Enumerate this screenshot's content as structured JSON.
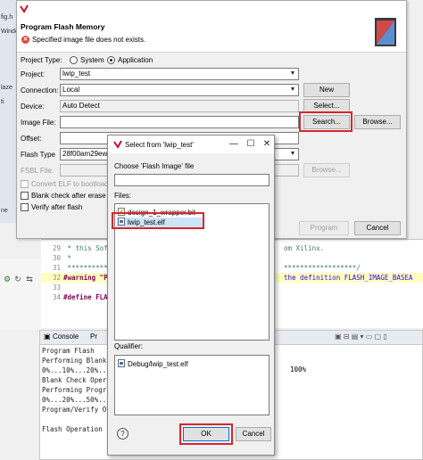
{
  "ide": {
    "side_labels": [
      "fig.h",
      "Windo",
      "laze",
      "ti",
      "ne"
    ],
    "code_lines": [
      {
        "num": "29",
        "text": " * this Soft",
        "tail": "om Xilinx."
      },
      {
        "num": "30",
        "text": " *",
        "tail": ""
      },
      {
        "num": "31",
        "text": " ***********",
        "tail": "******************/"
      },
      {
        "num": "32",
        "text": "#warning \"P",
        "tail": "the definition FLASH_IMAGE_BASEA"
      },
      {
        "num": "33",
        "text": "",
        "tail": ""
      },
      {
        "num": "34",
        "text": "#define FLA",
        "tail": ""
      }
    ],
    "console_tab": "Console",
    "second_tab": "Pr",
    "console_lines": [
      {
        "left": "Program Flash",
        "right": ""
      },
      {
        "left": "Performing Blank",
        "right": ""
      },
      {
        "left": "0%...10%...20%...",
        "right": "100%"
      },
      {
        "left": "Blank Check Oper",
        "right": ""
      },
      {
        "left": "Performing Progr",
        "right": ""
      },
      {
        "left": "0%...20%...50%..",
        "right": ""
      },
      {
        "left": "Program/Verify O",
        "right": ""
      },
      {
        "left": "",
        "right": ""
      },
      {
        "left": "Flash Operation",
        "right": ""
      }
    ]
  },
  "pfm": {
    "title": "Program Flash Memory",
    "error_message": "Specified image file does not exists.",
    "project_type_label": "Project Type:",
    "radio_system": "System",
    "radio_application": "Application",
    "project_label": "Project:",
    "project_value": "lwip_test",
    "connection_label": "Connection:",
    "connection_value": "Local",
    "new_button": "New",
    "device_label": "Device:",
    "device_value": "Auto Detect",
    "select_button": "Select...",
    "image_file_label": "Image File:",
    "image_file_value": "",
    "search_button": "Search...",
    "browse_button": "Browse...",
    "offset_label": "Offset:",
    "offset_value": "",
    "flash_type_label": "Flash Type",
    "flash_type_value": "28f00am29ew-b",
    "fsbl_file_label": "FSBL File:",
    "fsbl_browse_button": "Browse...",
    "convert_elf_label": "Convert ELF to bootloadab",
    "blank_check_label": "Blank check after erase",
    "verify_label": "Verify after flash",
    "program_button": "Program",
    "cancel_button": "Cancel"
  },
  "select_dialog": {
    "title": "Select from 'lwip_test'",
    "choose_label": "Choose 'Flash Image' file",
    "filter_value": "",
    "files_label": "Files:",
    "files": [
      {
        "name": "design_1_wrapper.bit",
        "icon": "bit-file-icon"
      },
      {
        "name": "lwip_test.elf",
        "icon": "elf-file-icon",
        "selected": true
      }
    ],
    "qualifier_label": "Qualifier:",
    "qualifier_items": [
      "Debug/lwip_test.elf"
    ],
    "help_icon": "?",
    "ok_button": "OK",
    "cancel_button": "Cancel"
  },
  "colors": {
    "highlight_red": "#d9262c",
    "selection_blue": "#cce4f7",
    "error_red": "#e0443e"
  }
}
